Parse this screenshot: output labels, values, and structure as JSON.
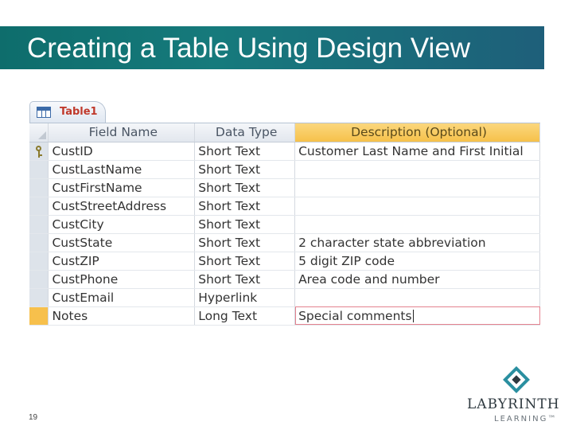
{
  "slide": {
    "title": "Creating a Table Using Design View",
    "page_number": "19"
  },
  "access": {
    "tab_label": "Table1",
    "headers": {
      "field_name": "Field Name",
      "data_type": "Data Type",
      "description": "Description (Optional)"
    },
    "rows": [
      {
        "field": "CustID",
        "type": "Short Text",
        "description": "Customer Last Name and First Initial",
        "primary_key": true
      },
      {
        "field": "CustLastName",
        "type": "Short Text",
        "description": ""
      },
      {
        "field": "CustFirstName",
        "type": "Short Text",
        "description": ""
      },
      {
        "field": "CustStreetAddress",
        "type": "Short Text",
        "description": ""
      },
      {
        "field": "CustCity",
        "type": "Short Text",
        "description": ""
      },
      {
        "field": "CustState",
        "type": "Short Text",
        "description": "2 character state abbreviation"
      },
      {
        "field": "CustZIP",
        "type": "Short Text",
        "description": "5 digit ZIP code"
      },
      {
        "field": "CustPhone",
        "type": "Short Text",
        "description": "Area code and number"
      },
      {
        "field": "CustEmail",
        "type": "Hyperlink",
        "description": ""
      },
      {
        "field": "Notes",
        "type": "Long Text",
        "description": "Special comments",
        "current": true
      }
    ]
  },
  "logo": {
    "name": "LABYRINTH",
    "sub": "LEARNING™"
  },
  "colors": {
    "title_bar": "#167a7c",
    "selected_header": "#f6c14a",
    "tab_label": "#c0392b"
  }
}
